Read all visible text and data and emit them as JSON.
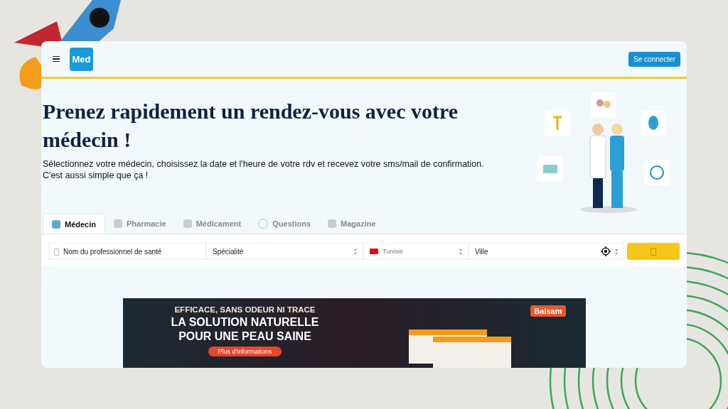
{
  "header": {
    "logo": "Med",
    "login_button": "Se connecter"
  },
  "hero": {
    "title": "Prenez rapidement un rendez-vous avec votre médecin !",
    "lines": [
      "Sélectionnez votre médecin, choisissez la date et l'heure de votre rdv et recevez votre sms/mail de confirmation.",
      "C'est aussi simple que ça !"
    ]
  },
  "tabs": [
    {
      "label": "Médecin",
      "kind": "doctor",
      "selected": true
    },
    {
      "label": "Pharmacie",
      "kind": "pharmacy",
      "selected": false
    },
    {
      "label": "Médicament",
      "kind": "drug",
      "selected": false
    },
    {
      "label": "Questions",
      "kind": "question",
      "selected": false
    },
    {
      "label": "Magazine",
      "kind": "magazine",
      "selected": false
    }
  ],
  "search": {
    "name_placeholder": "Nom du professionnel de santé",
    "specialty": "Spécialité",
    "country": "Tunisie",
    "city": "Ville"
  },
  "banner": {
    "tagline": "EFFICACE, SANS ODEUR NI TRACE",
    "headline": [
      "LA SOLUTION NATURELLE",
      "POUR UNE PEAU SAINE"
    ],
    "brand": "Balsam",
    "button": "Plus d'informations"
  }
}
